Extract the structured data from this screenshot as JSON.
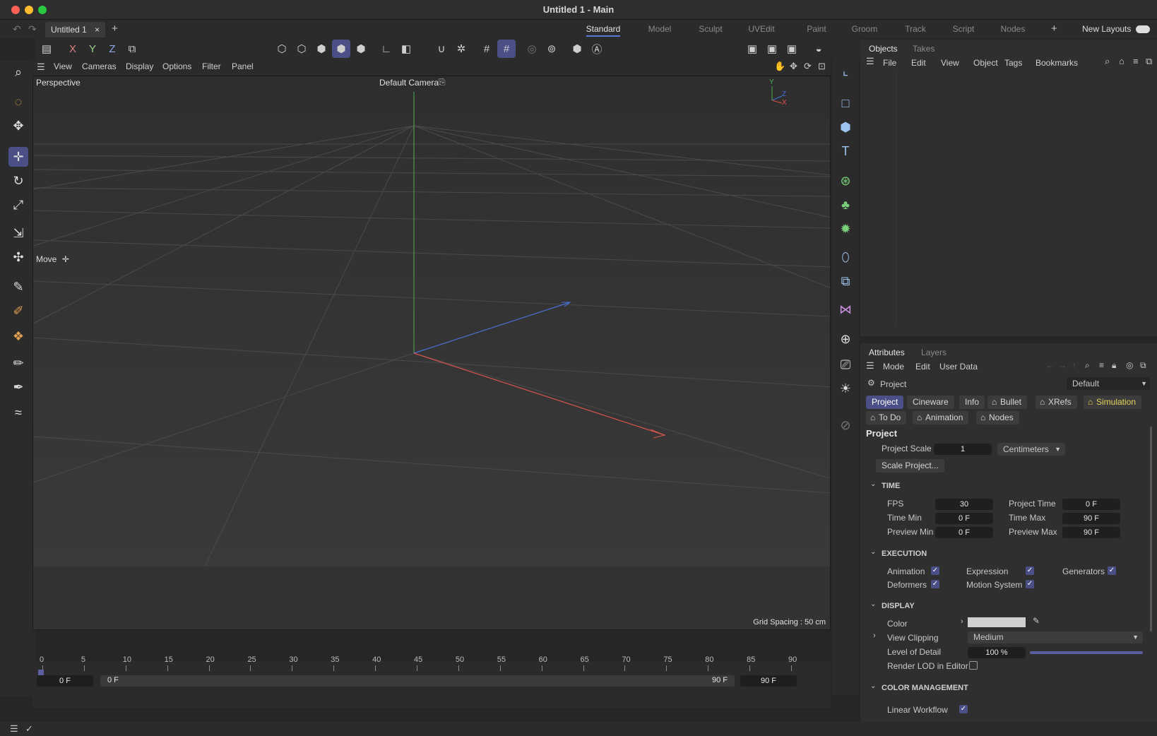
{
  "window": {
    "title": "Untitled 1 - Main"
  },
  "tabs": {
    "document_tab": "Untitled 1",
    "close_glyph": "×",
    "add_glyph": "+",
    "layouts": [
      "Standard",
      "Model",
      "Sculpt",
      "UVEdit",
      "Paint",
      "Groom",
      "Track",
      "Script",
      "Nodes"
    ],
    "active_layout": "Standard",
    "new_layouts": "New Layouts"
  },
  "toolbar": {
    "axes": [
      "X",
      "Y",
      "Z"
    ]
  },
  "viewport_menu": [
    "View",
    "Cameras",
    "Display",
    "Options",
    "Filter",
    "Panel"
  ],
  "viewport": {
    "view_name": "Perspective",
    "camera": "Default Camera",
    "tool_label": "Move",
    "grid_spacing": "Grid Spacing : 50 cm",
    "axis_labels": {
      "y": "Y",
      "z": "Z",
      "x": "X"
    }
  },
  "objects_panel": {
    "tabs": [
      "Objects",
      "Takes"
    ],
    "menu": [
      "File",
      "Edit",
      "View",
      "Object",
      "Tags",
      "Bookmarks"
    ]
  },
  "attributes_panel": {
    "tabs": [
      "Attributes",
      "Layers"
    ],
    "menu": [
      "Mode",
      "Edit",
      "User Data"
    ],
    "object_name": "Project",
    "preset": "Default",
    "chips_row1": [
      "Project",
      "Cineware",
      "Info",
      "Bullet",
      "XRefs",
      "Simulation"
    ],
    "chips_row2": [
      "To Do",
      "Animation",
      "Nodes"
    ],
    "heading": "Project",
    "project_scale_label": "Project Scale",
    "project_scale_value": "1",
    "project_scale_unit": "Centimeters",
    "scale_project_btn": "Scale Project...",
    "time_section": "TIME",
    "fps_label": "FPS",
    "fps": "30",
    "project_time_label": "Project Time",
    "project_time": "0 F",
    "time_min_label": "Time Min",
    "time_min": "0 F",
    "time_max_label": "Time Max",
    "time_max": "90 F",
    "preview_min_label": "Preview Min",
    "preview_min": "0 F",
    "preview_max_label": "Preview Max",
    "preview_max": "90 F",
    "execution_section": "EXECUTION",
    "exec": {
      "animation": "Animation",
      "expression": "Expression",
      "generators": "Generators",
      "deformers": "Deformers",
      "motion_system": "Motion System"
    },
    "display_section": "DISPLAY",
    "color_label": "Color",
    "view_clipping_label": "View Clipping",
    "view_clipping": "Medium",
    "lod_label": "Level of Detail",
    "lod": "100 %",
    "lod_fraction": 1.0,
    "render_lod_label": "Render LOD in Editor",
    "color_mgmt_section": "COLOR MANAGEMENT",
    "linear_workflow_label": "Linear Workflow",
    "checkmark": "✓"
  },
  "timeline": {
    "current_frame": "0 F",
    "ticks": [
      "0",
      "5",
      "10",
      "15",
      "20",
      "25",
      "30",
      "35",
      "40",
      "45",
      "50",
      "55",
      "60",
      "65",
      "70",
      "75",
      "80",
      "85",
      "90"
    ],
    "range_start": "0 F",
    "range_inner_start": "0 F",
    "range_inner_end": "90 F",
    "range_end": "90 F"
  },
  "colors": {
    "accent": "#4a4f85",
    "x_axis": "#d9534f",
    "y_axis": "#4caf50",
    "z_axis": "#4a6fd6"
  }
}
